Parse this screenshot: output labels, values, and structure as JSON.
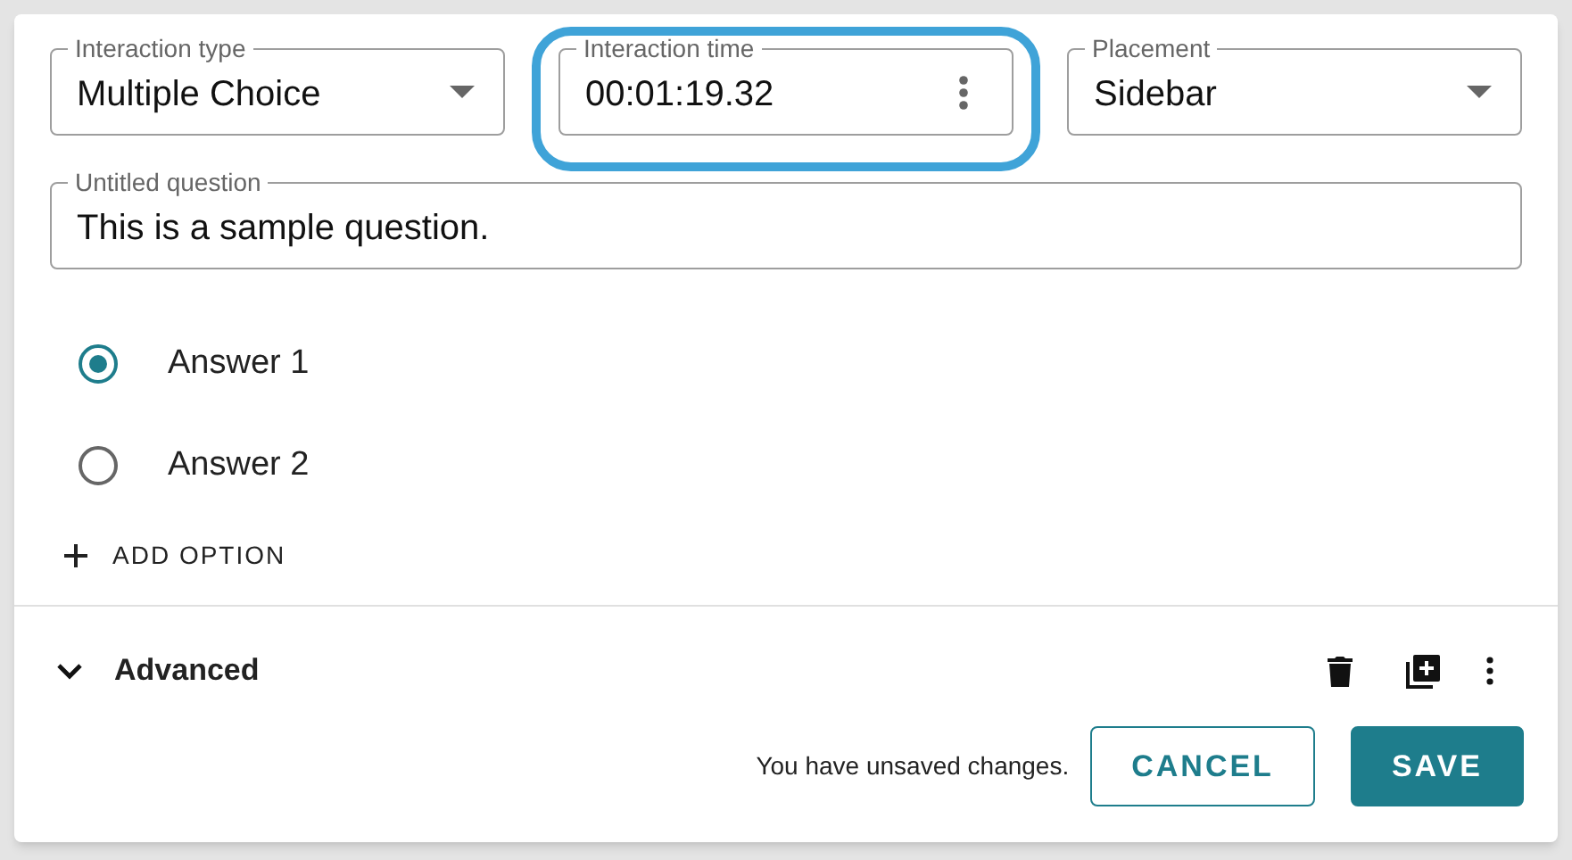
{
  "fields": [
    {
      "kind": "select",
      "label": "Interaction type",
      "value": "Multiple Choice"
    },
    {
      "kind": "menu",
      "label": "Interaction time",
      "value": "00:01:19.32",
      "highlighted": true
    },
    {
      "kind": "select",
      "label": "Placement",
      "value": "Sidebar"
    }
  ],
  "question": {
    "label": "Untitled question",
    "value": "This is a sample question."
  },
  "answers": [
    {
      "label": "Answer 1",
      "selected": true
    },
    {
      "label": "Answer 2",
      "selected": false
    }
  ],
  "add_option": {
    "label": "ADD OPTION"
  },
  "advanced": {
    "label": "Advanced"
  },
  "footer": {
    "message": "You have unsaved changes.",
    "buttons": [
      {
        "kind": "outlined",
        "label": "CANCEL"
      },
      {
        "kind": "filled",
        "label": "SAVE"
      }
    ]
  }
}
